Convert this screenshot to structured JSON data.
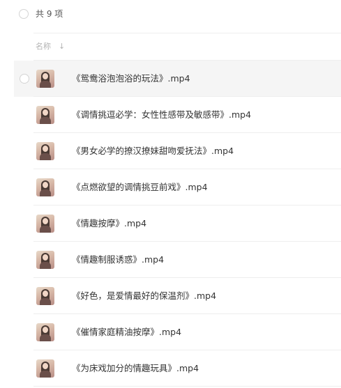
{
  "header": {
    "count_label": "共 9 项",
    "column_name": "名称",
    "sort_arrow": "↓"
  },
  "files": [
    {
      "title": "《鸳鸯浴泡泡浴的玩法》.mp4",
      "selected": true
    },
    {
      "title": "《调情挑逗必学：女性性感带及敏感带》.mp4",
      "selected": false
    },
    {
      "title": "《男女必学的撩汉撩妹甜吻爱抚法》.mp4",
      "selected": false
    },
    {
      "title": "《点燃欲望的调情挑豆前戏》.mp4",
      "selected": false
    },
    {
      "title": "《情趣按摩》.mp4",
      "selected": false
    },
    {
      "title": "《情趣制服诱惑》.mp4",
      "selected": false
    },
    {
      "title": "《好色，是爱情最好的保温剂》.mp4",
      "selected": false
    },
    {
      "title": "《催情家庭精油按摩》.mp4",
      "selected": false
    },
    {
      "title": "《为床戏加分的情趣玩具》.mp4",
      "selected": false
    }
  ],
  "colors": {
    "row_hover_bg": "#f5f5f5",
    "divider": "#eeeeee",
    "text": "#333333",
    "muted": "#b3b3b3"
  }
}
